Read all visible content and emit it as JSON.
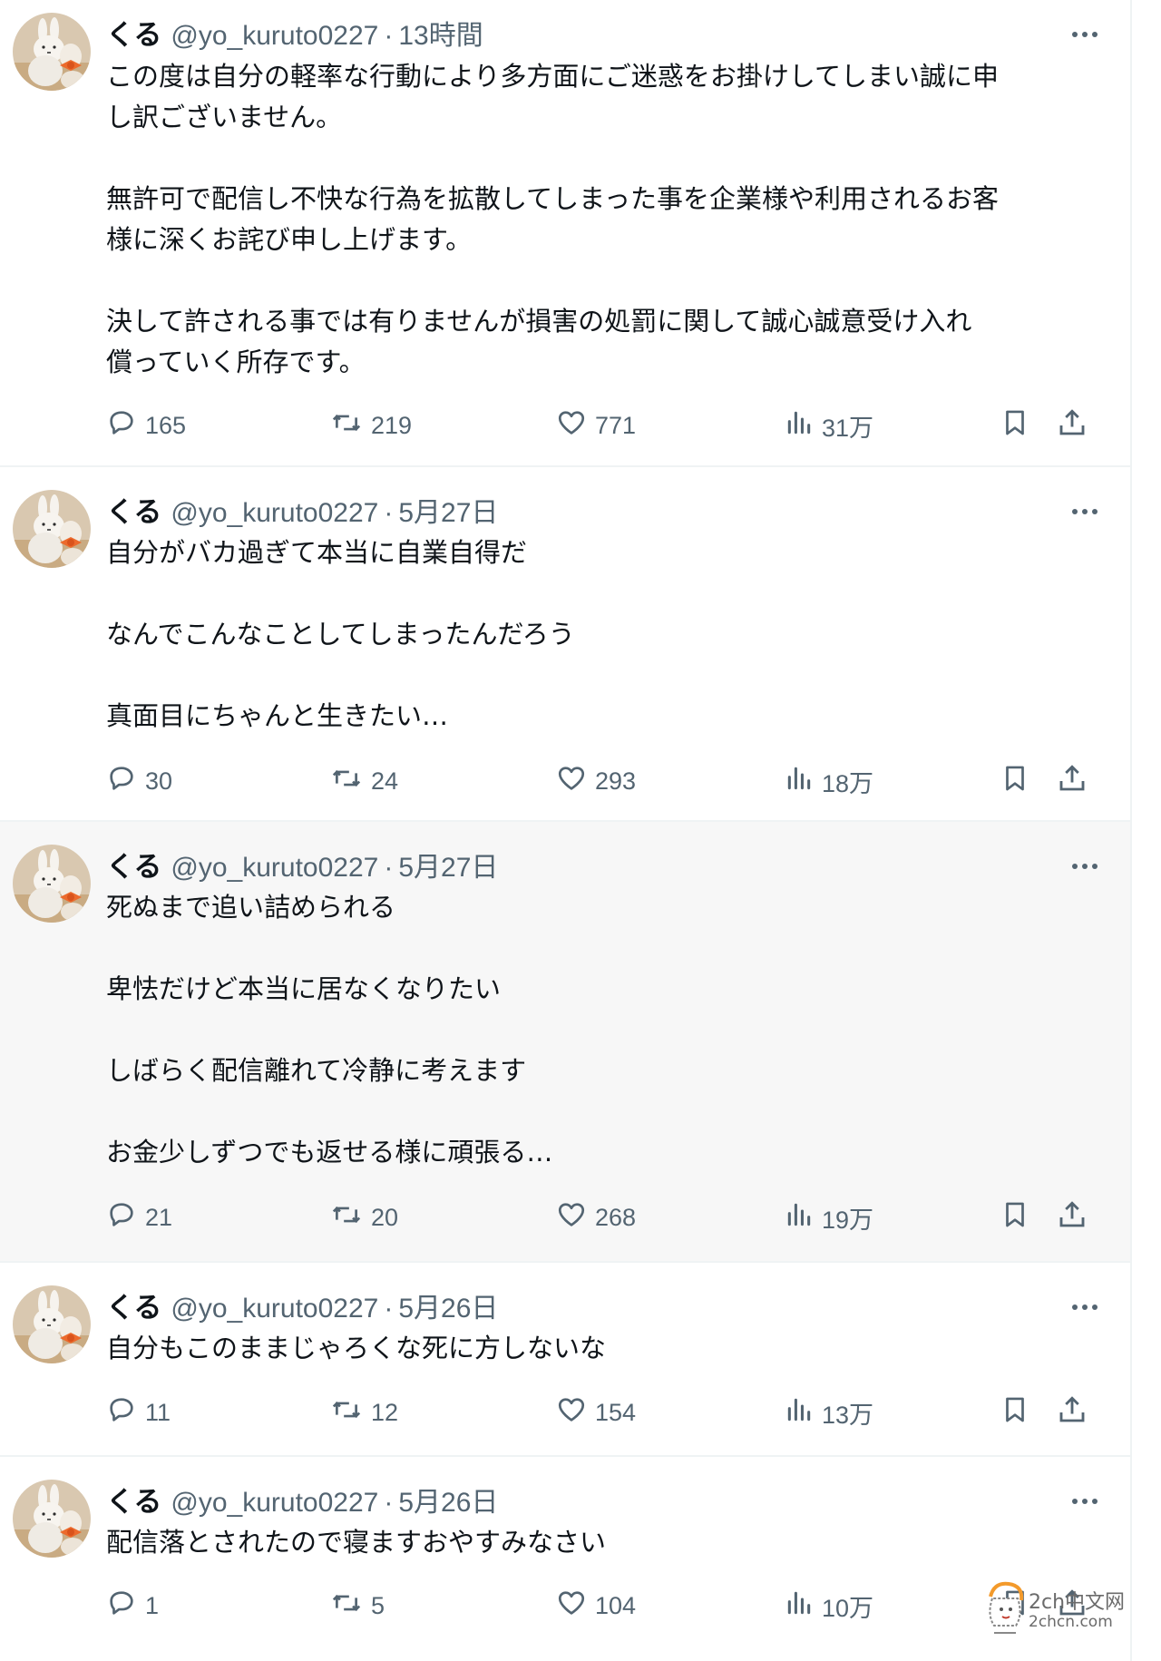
{
  "tweets": [
    {
      "name": "くる",
      "handle": "@yo_kuruto0227",
      "separator": "·",
      "time": "13時間",
      "text": "この度は自分の軽率な行動により多方面にご迷惑をお掛けしてしまい誠に申\nし訳ございません。\n\n無許可で配信し不快な行為を拡散してしまった事を企業様や利用されるお客\n様に深くお詫び申し上げます。\n\n決して許される事では有りませんが損害の処罰に関して誠心誠意受け入れ\n償っていく所存です。",
      "replies": "165",
      "retweets": "219",
      "likes": "771",
      "views": "31万"
    },
    {
      "name": "くる",
      "handle": "@yo_kuruto0227",
      "separator": "·",
      "time": "5月27日",
      "text": "自分がバカ過ぎて本当に自業自得だ\n\nなんでこんなことしてしまったんだろう\n\n真面目にちゃんと生きたい…",
      "replies": "30",
      "retweets": "24",
      "likes": "293",
      "views": "18万"
    },
    {
      "name": "くる",
      "handle": "@yo_kuruto0227",
      "separator": "·",
      "time": "5月27日",
      "text": "死ぬまで追い詰められる\n\n卑怯だけど本当に居なくなりたい\n\nしばらく配信離れて冷静に考えます\n\nお金少しずつでも返せる様に頑張る…",
      "replies": "21",
      "retweets": "20",
      "likes": "268",
      "views": "19万"
    },
    {
      "name": "くる",
      "handle": "@yo_kuruto0227",
      "separator": "·",
      "time": "5月26日",
      "text": "自分もこのままじゃろくな死に方しないな",
      "replies": "11",
      "retweets": "12",
      "likes": "154",
      "views": "13万"
    },
    {
      "name": "くる",
      "handle": "@yo_kuruto0227",
      "separator": "·",
      "time": "5月26日",
      "text": "配信落とされたので寝ますおやすみなさい",
      "replies": "1",
      "retweets": "5",
      "likes": "104",
      "views": "10万"
    }
  ],
  "icons": {
    "more": "more-icon",
    "reply": "reply-icon",
    "retweet": "retweet-icon",
    "like": "heart-icon",
    "views": "views-icon",
    "bookmark": "bookmark-icon",
    "share": "share-icon"
  },
  "colors": {
    "text": "#0f1419",
    "secondary": "#536471",
    "divider": "#eff3f4",
    "hover_background": "#f7f7f7"
  },
  "watermark": {
    "title": "2ch中文网",
    "domain": "2chcn.com"
  }
}
